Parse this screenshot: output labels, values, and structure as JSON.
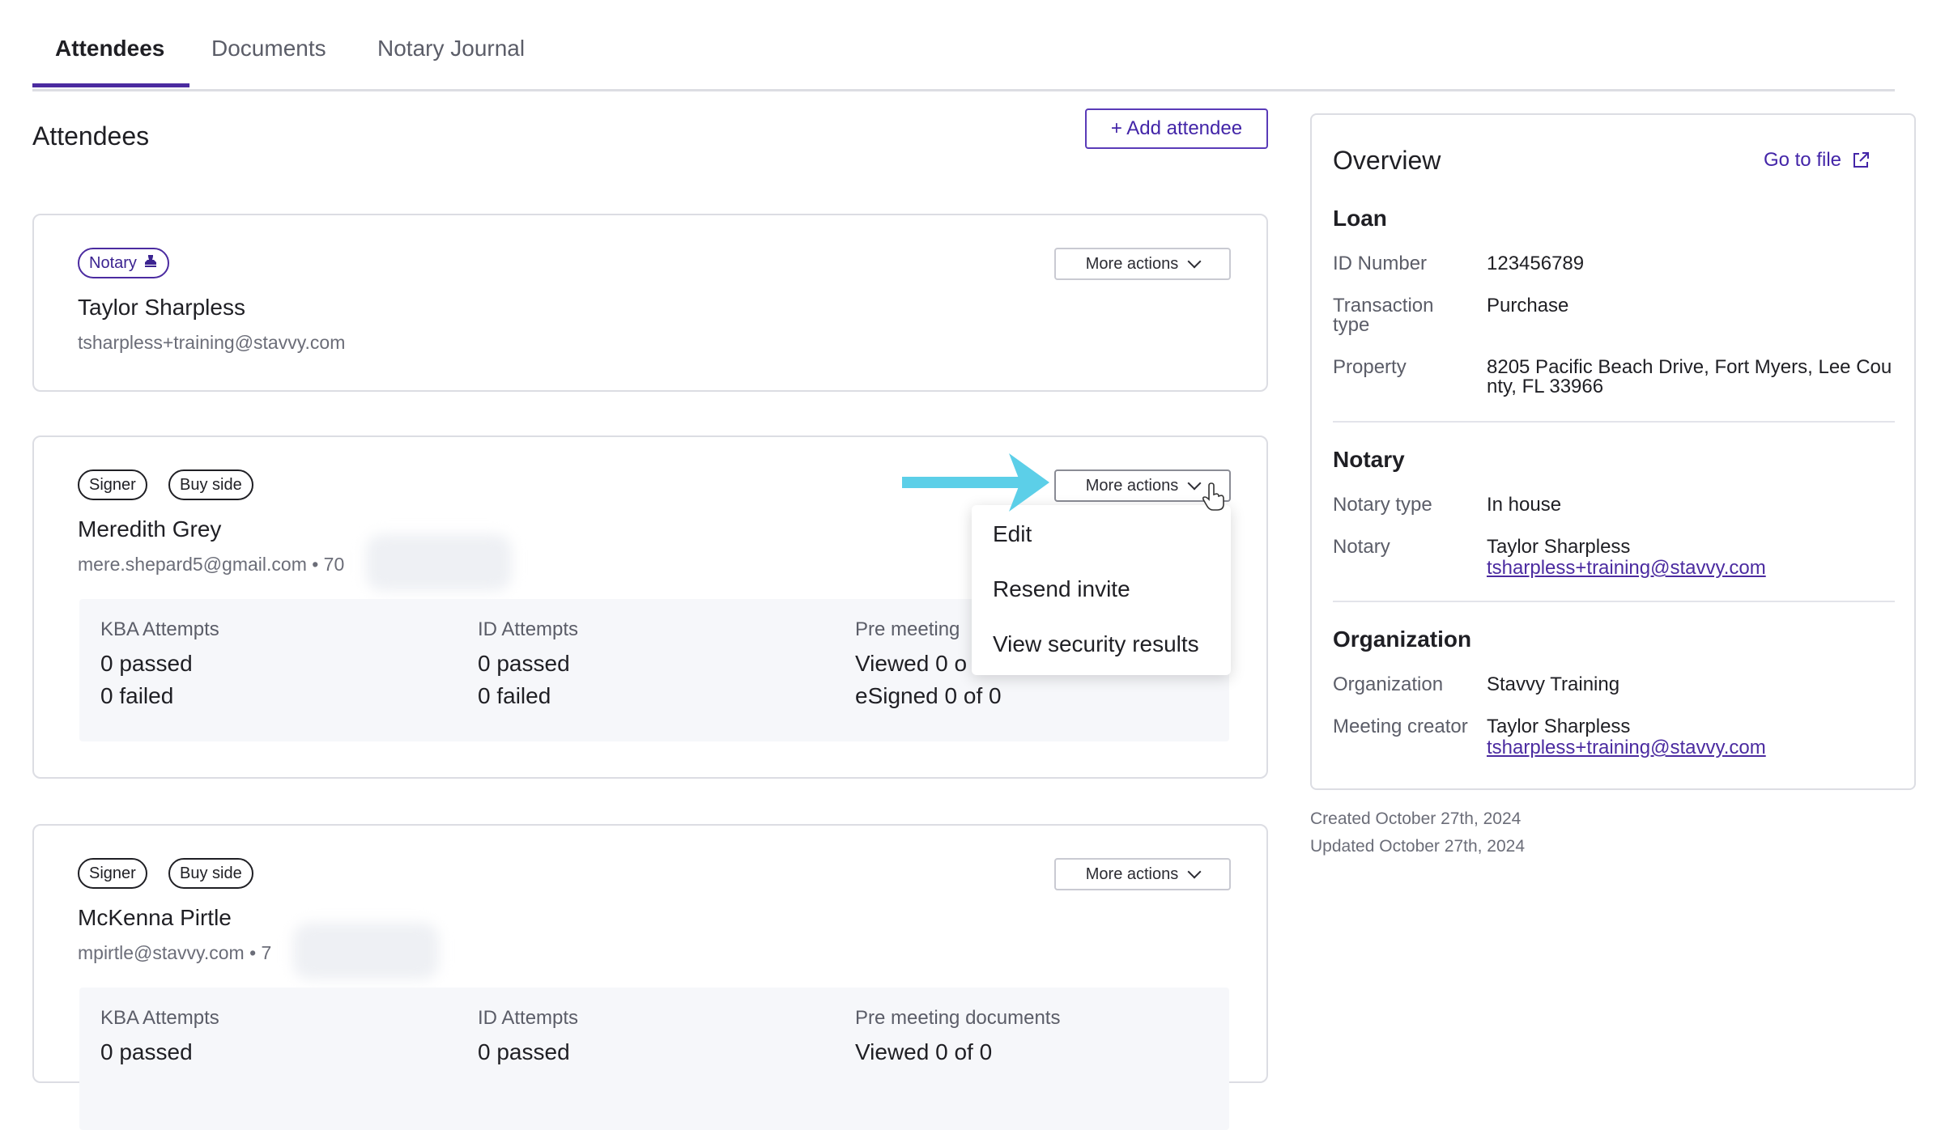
{
  "tabs": [
    {
      "label": "Attendees",
      "active": true
    },
    {
      "label": "Documents",
      "active": false
    },
    {
      "label": "Notary Journal",
      "active": false
    }
  ],
  "section_title": "Attendees",
  "add_attendee_label": "+ Add attendee",
  "more_actions_label": "More actions",
  "attendees": [
    {
      "tags": [
        "Notary"
      ],
      "name": "Taylor Sharpless",
      "email": "tsharpless+training@stavvy.com"
    },
    {
      "tags": [
        "Signer",
        "Buy side"
      ],
      "name": "Meredith Grey",
      "email": "mere.shepard5@gmail.com • 70",
      "stats": {
        "kba_label": "KBA Attempts",
        "kba_passed": "0 passed",
        "kba_failed": "0 failed",
        "id_label": "ID Attempts",
        "id_passed": "0 passed",
        "id_failed": "0 failed",
        "pre_label": "Pre meeting",
        "pre_viewed": "Viewed 0 o",
        "pre_esigned": "eSigned 0 of 0"
      }
    },
    {
      "tags": [
        "Signer",
        "Buy side"
      ],
      "name": "McKenna Pirtle",
      "email": "mpirtle@stavvy.com • 7",
      "stats": {
        "kba_label": "KBA Attempts",
        "kba_passed": "0 passed",
        "id_label": "ID Attempts",
        "id_passed": "0 passed",
        "pre_label": "Pre meeting documents",
        "pre_viewed": "Viewed 0 of 0"
      }
    }
  ],
  "dropdown": {
    "items": [
      "Edit",
      "Resend invite",
      "View security results"
    ]
  },
  "overview": {
    "title": "Overview",
    "goto_label": "Go to file",
    "loan": {
      "heading": "Loan",
      "id_label": "ID Number",
      "id_value": "123456789",
      "transaction_label": "Transaction type",
      "transaction_value": "Purchase",
      "property_label": "Property",
      "property_value": "8205 Pacific Beach Drive, Fort Myers, Lee County, FL 33966"
    },
    "notary": {
      "heading": "Notary",
      "type_label": "Notary type",
      "type_value": "In house",
      "notary_label": "Notary",
      "notary_name": "Taylor Sharpless",
      "notary_email": "tsharpless+training@stavvy.com"
    },
    "organization": {
      "heading": "Organization",
      "org_label": "Organization",
      "org_value": "Stavvy Training",
      "creator_label": "Meeting creator",
      "creator_name": "Taylor Sharpless",
      "creator_email": "tsharpless+training@stavvy.com"
    }
  },
  "meta": {
    "created": "Created October 27th, 2024",
    "updated": "Updated October 27th, 2024"
  },
  "colors": {
    "accent": "#4b2ba0",
    "arrow": "#5ccfe8"
  }
}
